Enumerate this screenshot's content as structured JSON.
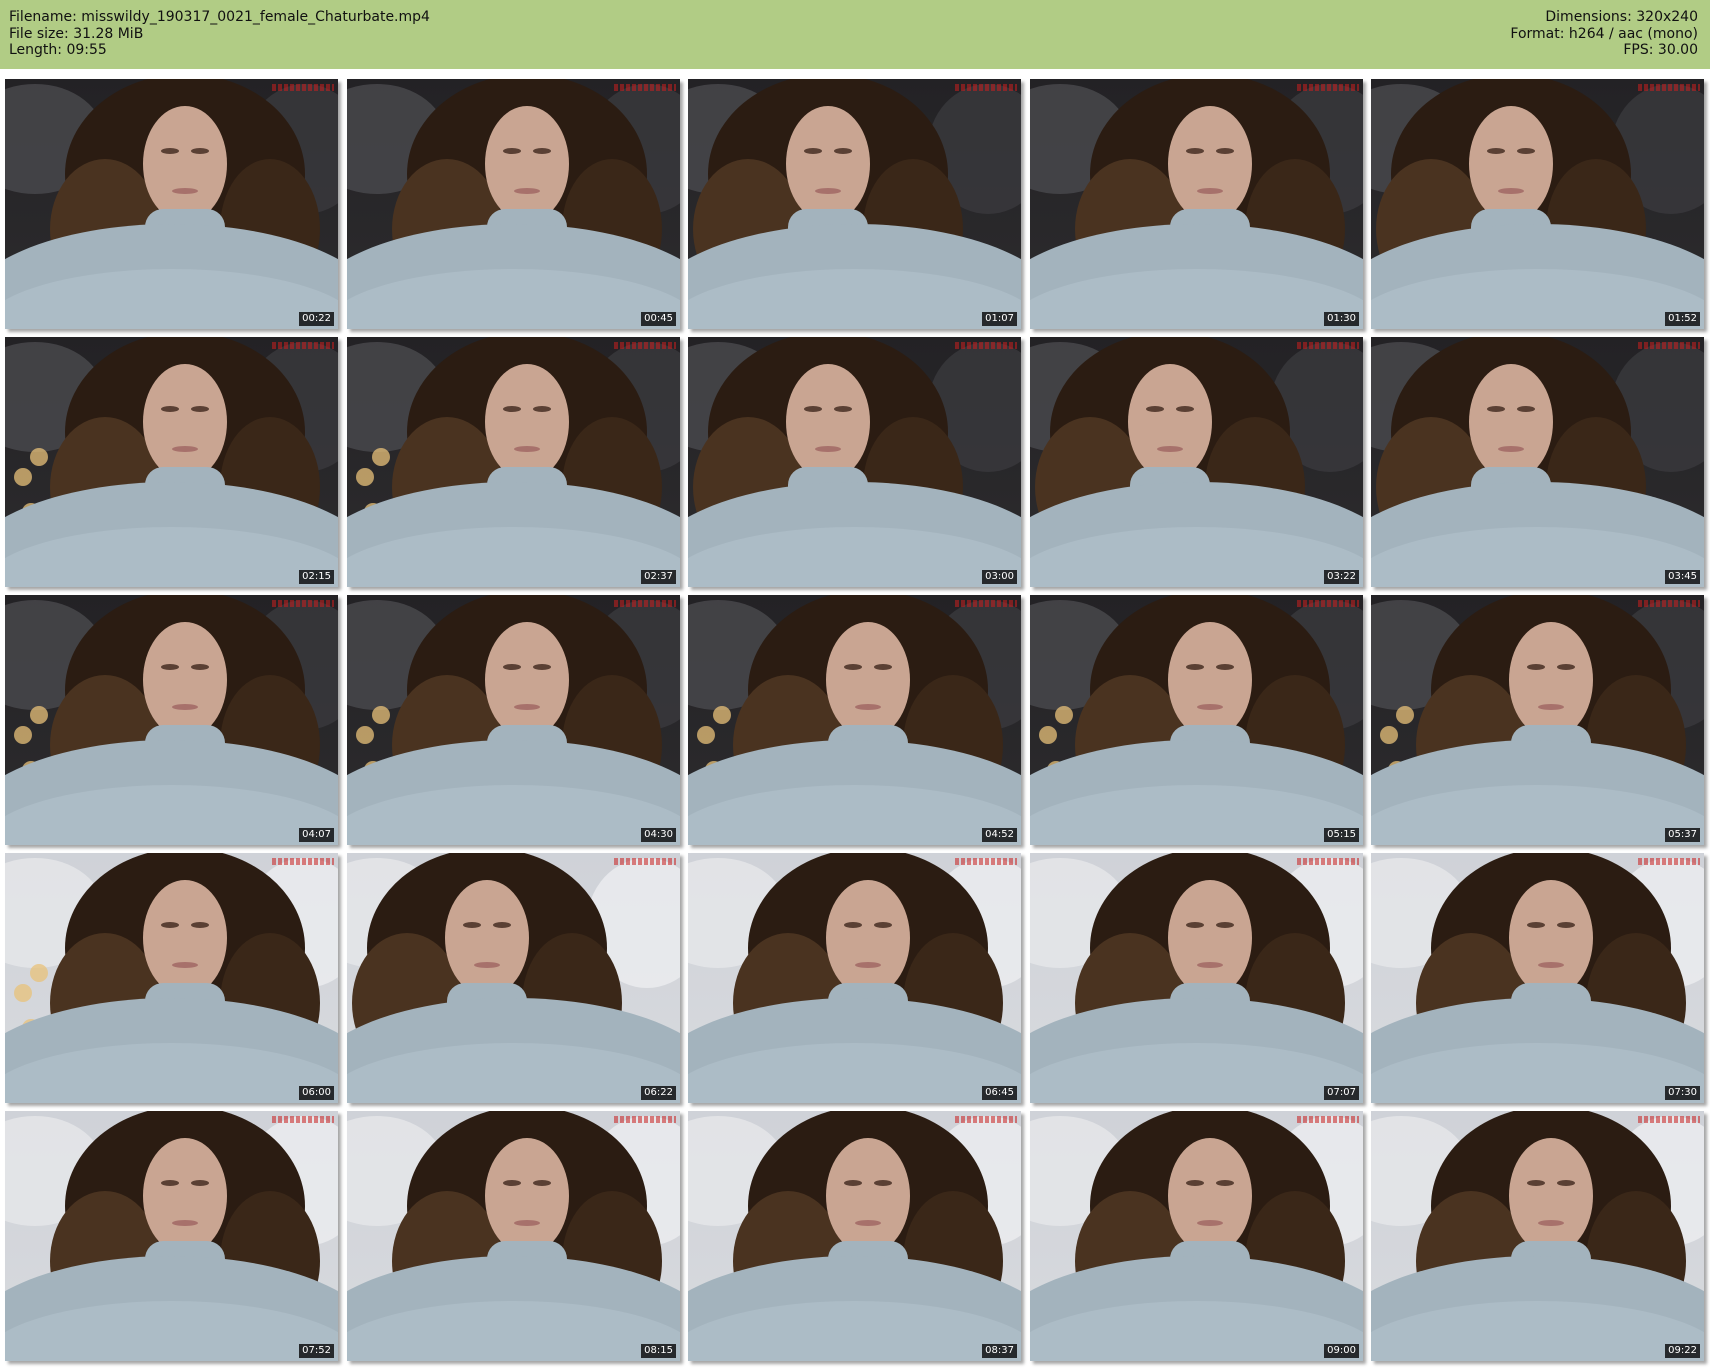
{
  "header": {
    "filename": "Filename: misswildy_190317_0021_female_Chaturbate.mp4",
    "filesize": "File size: 31.28 MiB",
    "length": "Length: 09:55",
    "dimensions": "Dimensions: 320x240",
    "format": "Format: h264 / aac (mono)",
    "fps": "FPS: 30.00"
  },
  "colors": {
    "header_bg": "#b1cc85",
    "sweater": "#a3b3bd",
    "hair": "#2b1c12",
    "skin": "#c9a592",
    "background_dark": "#2d2c2e",
    "background_light": "#d8dade",
    "warm_light": "#e8c27a"
  },
  "thumbnails": [
    {
      "time": "00:22",
      "bg": "dark",
      "face": "center",
      "lights": false
    },
    {
      "time": "00:45",
      "bg": "dark",
      "face": "center",
      "lights": false
    },
    {
      "time": "01:07",
      "bg": "dark",
      "face": "left",
      "lights": false
    },
    {
      "time": "01:30",
      "bg": "dark",
      "face": "center",
      "lights": false
    },
    {
      "time": "01:52",
      "bg": "dark",
      "face": "left",
      "lights": false
    },
    {
      "time": "02:15",
      "bg": "dark",
      "face": "center",
      "lights": true
    },
    {
      "time": "02:37",
      "bg": "dark",
      "face": "center",
      "lights": true
    },
    {
      "time": "03:00",
      "bg": "dark",
      "face": "left",
      "lights": false
    },
    {
      "time": "03:22",
      "bg": "dark",
      "face": "left",
      "lights": true
    },
    {
      "time": "03:45",
      "bg": "dark",
      "face": "left",
      "lights": true
    },
    {
      "time": "04:07",
      "bg": "dark",
      "face": "center",
      "lights": true
    },
    {
      "time": "04:30",
      "bg": "dark",
      "face": "center",
      "lights": true
    },
    {
      "time": "04:52",
      "bg": "dark",
      "face": "center",
      "lights": true
    },
    {
      "time": "05:15",
      "bg": "dark",
      "face": "center",
      "lights": true
    },
    {
      "time": "05:37",
      "bg": "dark",
      "face": "center",
      "lights": true
    },
    {
      "time": "06:00",
      "bg": "light",
      "face": "center",
      "lights": true
    },
    {
      "time": "06:22",
      "bg": "light",
      "face": "left",
      "lights": false
    },
    {
      "time": "06:45",
      "bg": "light",
      "face": "center",
      "lights": false
    },
    {
      "time": "07:07",
      "bg": "light",
      "face": "center",
      "lights": false
    },
    {
      "time": "07:30",
      "bg": "light",
      "face": "center",
      "lights": false
    },
    {
      "time": "07:52",
      "bg": "light",
      "face": "center",
      "lights": false
    },
    {
      "time": "08:15",
      "bg": "light",
      "face": "center",
      "lights": false
    },
    {
      "time": "08:37",
      "bg": "light",
      "face": "center",
      "lights": false
    },
    {
      "time": "09:00",
      "bg": "light",
      "face": "center",
      "lights": false
    },
    {
      "time": "09:22",
      "bg": "light",
      "face": "center",
      "lights": false
    }
  ]
}
